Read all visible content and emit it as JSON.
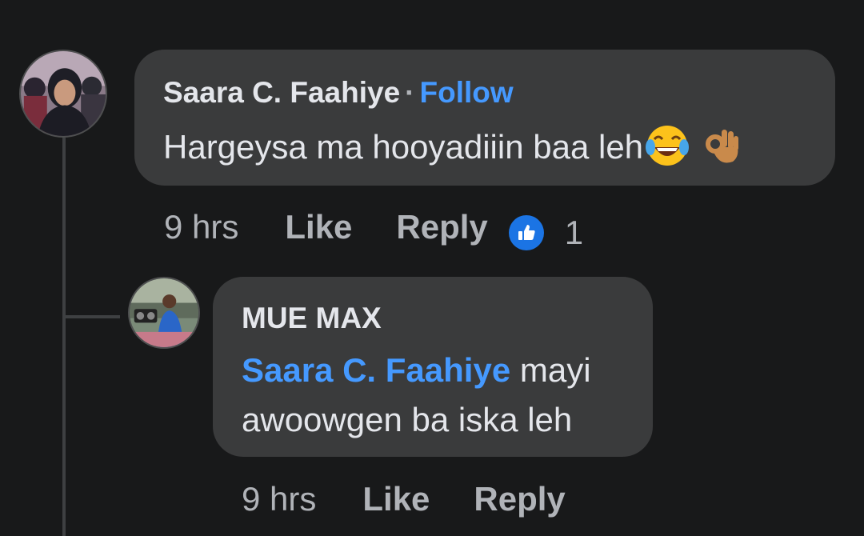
{
  "comment": {
    "author": "Saara C. Faahiye",
    "separator": "·",
    "follow_label": "Follow",
    "text": "Hargeysa ma hooyadiiin baa leh",
    "emojis": [
      "face-with-tears-of-joy-icon",
      "ok-hand-icon"
    ],
    "timestamp": "9 hrs",
    "like_label": "Like",
    "reply_label": "Reply",
    "reaction_icon": "like-reaction-icon",
    "reaction_count": "1"
  },
  "reply": {
    "author": "MUE MAX",
    "mention": "Saara C. Faahiye",
    "text": " mayi awoowgen ba iska leh",
    "timestamp": "9 hrs",
    "like_label": "Like",
    "reply_label": "Reply"
  },
  "colors": {
    "background": "#18191a",
    "bubble": "#3a3b3c",
    "link": "#4599ff",
    "secondary_text": "#b0b3b8",
    "primary_text": "#e4e6eb",
    "like_badge": "#1b74e4"
  }
}
